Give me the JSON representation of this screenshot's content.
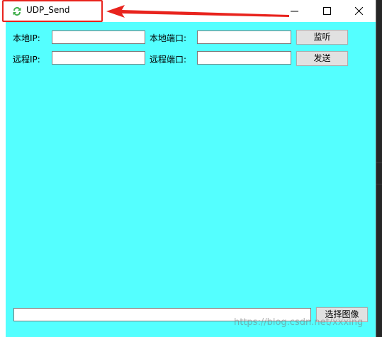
{
  "window": {
    "title": "UDP_Send",
    "controls": [
      "minimize-icon",
      "maximize-icon",
      "close-icon"
    ]
  },
  "annotation": {
    "color": "#e8231d"
  },
  "form": {
    "local_ip_label": "本地IP:",
    "local_ip_value": "",
    "local_port_label": "本地端口:",
    "local_port_value": "",
    "listen_button": "监听",
    "remote_ip_label": "远程IP:",
    "remote_ip_value": "",
    "remote_port_label": "远程端口:",
    "remote_port_value": "",
    "send_button": "发送"
  },
  "bottom": {
    "path_value": "",
    "select_image_button": "选择图像"
  },
  "colors": {
    "client_bg": "#54ffff"
  },
  "watermark": "https://blog.csdn.net/xxxing"
}
